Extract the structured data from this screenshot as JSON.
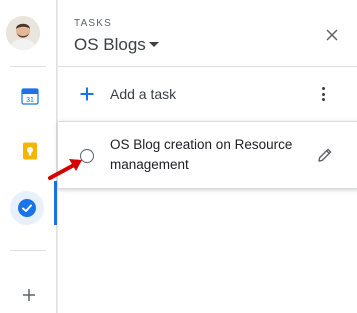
{
  "rail": {
    "icons": [
      "avatar",
      "calendar-icon",
      "keep-icon",
      "tasks-icon",
      "plus-icon"
    ],
    "calendar_day": "31",
    "active": "tasks"
  },
  "panel": {
    "eyebrow": "TASKS",
    "list_title": "OS Blogs",
    "add_task_label": "Add a task",
    "tasks": [
      {
        "text": "OS Blog creation on Resource management"
      }
    ]
  },
  "colors": {
    "accent_blue": "#1a73e8",
    "keep_yellow": "#f4b400",
    "annotation_arrow": "#d50000",
    "text_primary": "#202124",
    "text_secondary": "#5f6368"
  }
}
